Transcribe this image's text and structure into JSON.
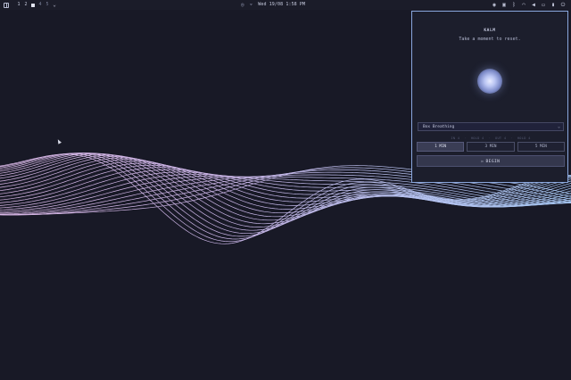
{
  "topbar": {
    "workspaces": [
      "1",
      "2",
      "",
      "4",
      "5"
    ],
    "clock": "Wed 19/08 1:58 PM",
    "tray_icons": [
      "camera-icon",
      "calendar-icon",
      "bluetooth-icon",
      "wifi-icon",
      "volume-icon",
      "monitor-icon",
      "battery-icon",
      "power-icon"
    ]
  },
  "panel": {
    "title": "KALM",
    "subtitle": "Take a moment to reset.",
    "pattern_selected": "Box Breathing",
    "phases": [
      "IN 4",
      "HOLD 4",
      "OUT 4",
      "HOLD 4"
    ],
    "durations": [
      {
        "label": "1 MIN",
        "active": true
      },
      {
        "label": "3 MIN",
        "active": false
      },
      {
        "label": "5 MIN",
        "active": false
      }
    ],
    "begin_label": "BEGIN",
    "accent_color": "#8aa7de"
  },
  "background": {
    "color": "#181926",
    "wave_colors": [
      "#d6b4e4",
      "#a9c3f0"
    ]
  }
}
